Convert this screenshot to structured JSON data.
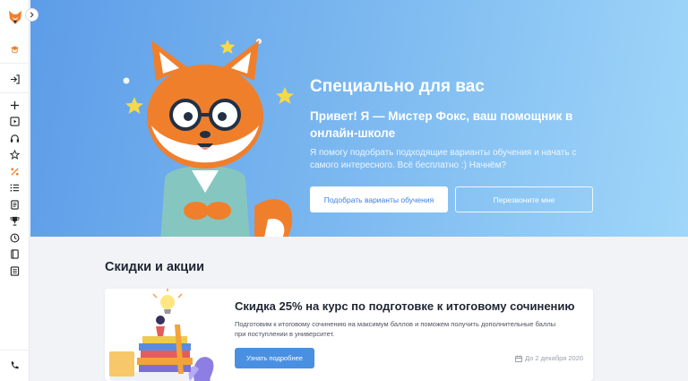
{
  "sidebar": {
    "logo": "fox-logo-icon",
    "collapse_icon": "chevron-right-icon",
    "items": [
      {
        "name": "graduation-cap-icon"
      },
      {
        "name": "login-icon"
      },
      {
        "name": "plus-icon"
      },
      {
        "name": "play-square-icon"
      },
      {
        "name": "headphones-icon"
      },
      {
        "name": "star-icon"
      },
      {
        "name": "percent-icon"
      },
      {
        "name": "list-icon"
      },
      {
        "name": "document-icon"
      },
      {
        "name": "trophy-icon"
      },
      {
        "name": "clock-icon"
      },
      {
        "name": "notebook-icon"
      },
      {
        "name": "notes-icon"
      }
    ],
    "bottom_icon": "phone-icon"
  },
  "hero": {
    "title": "Специально для вас",
    "subtitle": "Привет! Я — Мистер Фокс, ваш помощник в онлайн-школе",
    "text": "Я помогу подобрать подходящие варианты обучения и начать с самого интересного. Всё бесплатно :) Начнём?",
    "primary_button": "Подобрать варианты обучения",
    "secondary_button": "Перезвоните мне"
  },
  "section": {
    "title": "Скидки и акции"
  },
  "promo": {
    "title": "Скидка 25% на курс по подготовке к итоговому сочинению",
    "description": "Подготовим к итоговому сочинению на максимум баллов и поможем получить дополнительные баллы при поступлении в университет.",
    "button": "Узнать подробнее",
    "date": "До 2 декабря 2020"
  },
  "colors": {
    "accent": "#4a90e2",
    "sidebar_accent": "#f07f2c"
  }
}
